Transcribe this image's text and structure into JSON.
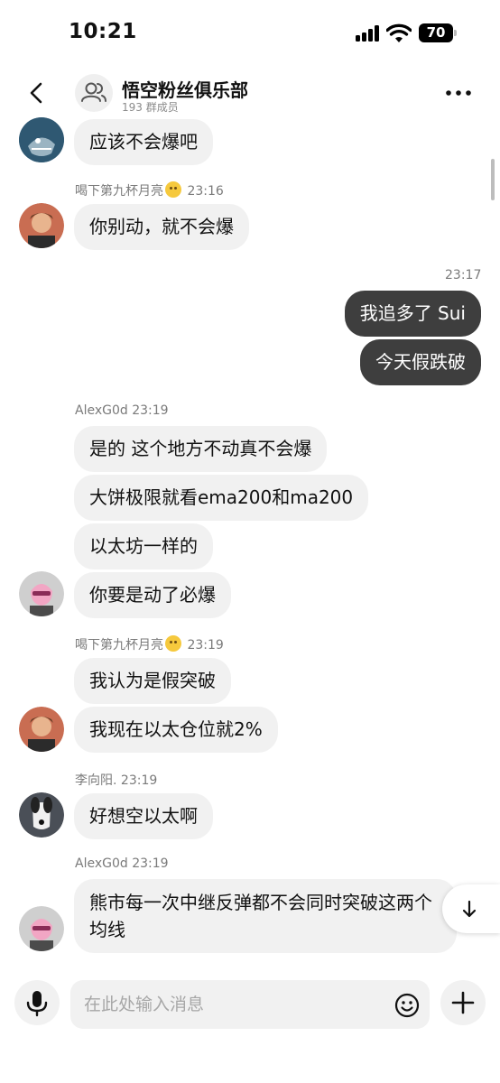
{
  "status_bar": {
    "time": "10:21",
    "battery": "70"
  },
  "header": {
    "title": "悟空粉丝俱乐部",
    "members": "193 群成员"
  },
  "messages": [
    {
      "text": "应该不会爆吧"
    },
    {
      "sender": "喝下第九杯月亮",
      "time": "23:16",
      "text": "你别动，就不会爆"
    },
    {
      "time_divider": "23:17"
    },
    {
      "text": "我追多了 Sui"
    },
    {
      "text": "今天假跌破"
    },
    {
      "sender": "AlexG0d",
      "time": "23:19",
      "text": "是的 这个地方不动真不会爆"
    },
    {
      "text": "大饼极限就看ema200和ma200"
    },
    {
      "text": "以太坊一样的"
    },
    {
      "text": "你要是动了必爆"
    },
    {
      "sender": "喝下第九杯月亮",
      "time": "23:19",
      "text": "我认为是假突破"
    },
    {
      "text": "我现在以太仓位就2%"
    },
    {
      "sender": "李向阳.",
      "time": "23:19",
      "text": "好想空以太啊"
    },
    {
      "sender": "AlexG0d",
      "time": "23:19",
      "text": "熊市每一次中继反弹都不会同时突破这两个均线"
    }
  ],
  "input": {
    "placeholder": "在此处输入消息"
  },
  "icons": {
    "back": "chevron-left-icon",
    "group": "group-icon",
    "more": "more-dots-icon",
    "mic": "microphone-icon",
    "emoji": "smiley-icon",
    "plus": "plus-icon",
    "jump": "arrow-down-icon"
  }
}
